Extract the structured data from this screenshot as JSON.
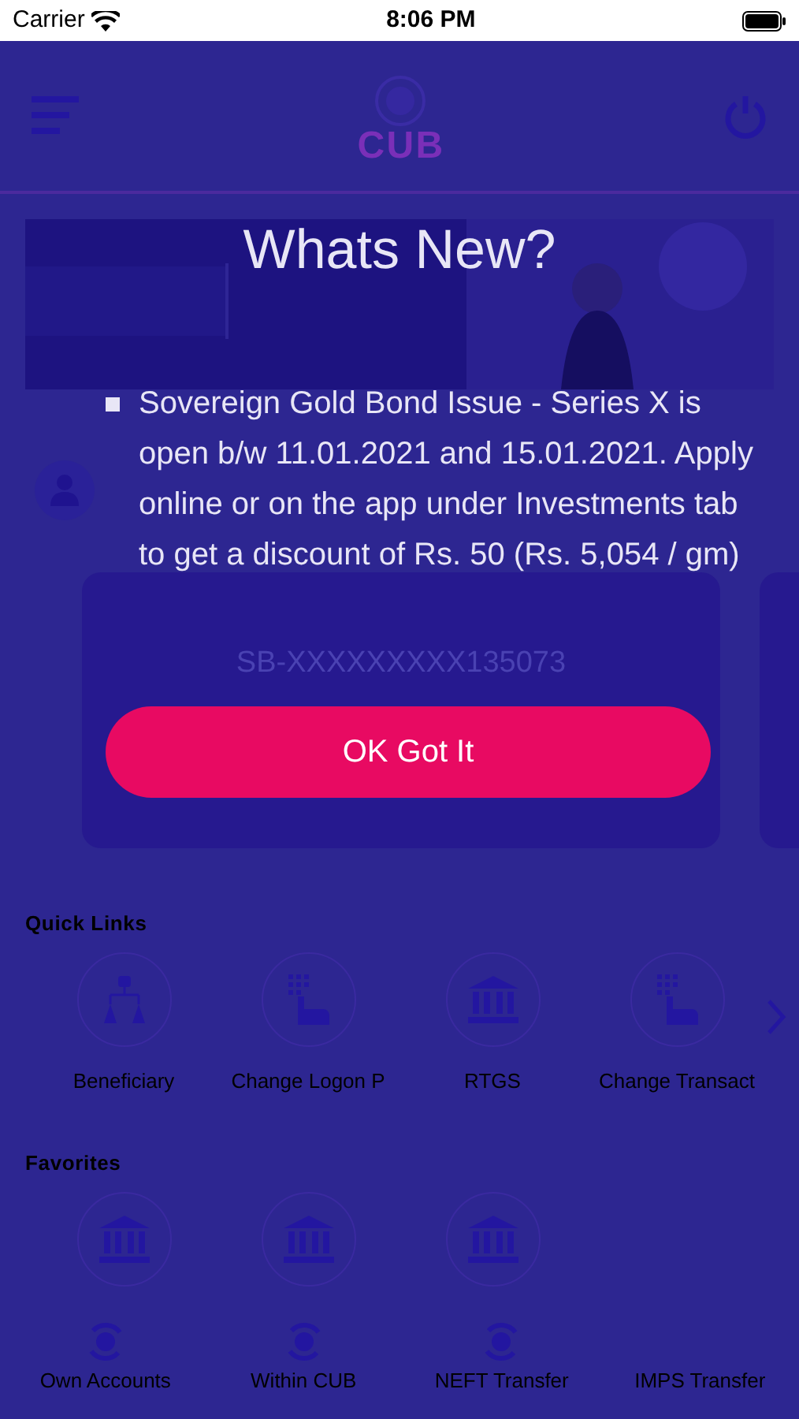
{
  "status_bar": {
    "carrier": "Carrier",
    "time": "8:06 PM"
  },
  "header": {
    "logo_text": "CUB"
  },
  "account_card": {
    "number": "SB-XXXXXXXXX135073"
  },
  "quick_links": {
    "title": "Quick Links",
    "items": [
      {
        "label": "Beneficiary",
        "kind": "people"
      },
      {
        "label": "Change Logon P",
        "kind": "keypad"
      },
      {
        "label": "RTGS",
        "kind": "bank"
      },
      {
        "label": "Change Transact",
        "kind": "keypad"
      }
    ]
  },
  "favorites": {
    "title": "Favorites",
    "items": [
      {
        "kind": "bank"
      },
      {
        "kind": "bank"
      },
      {
        "kind": "bank"
      }
    ]
  },
  "transfers": [
    {
      "label": "Own Accounts",
      "kind": "coin"
    },
    {
      "label": "Within CUB",
      "kind": "coin"
    },
    {
      "label": "NEFT Transfer",
      "kind": "coin"
    },
    {
      "label": "IMPS Transfer",
      "kind": "none"
    }
  ],
  "dialog": {
    "title": "Whats New?",
    "items": [
      "Sovereign Gold Bond Issue - Series X is open b/w 11.01.2021 and 15.01.2021. Apply online or on the app under Investments tab to get a discount of Rs. 50 (Rs. 5,054 / gm)"
    ],
    "button": "OK Got It"
  }
}
